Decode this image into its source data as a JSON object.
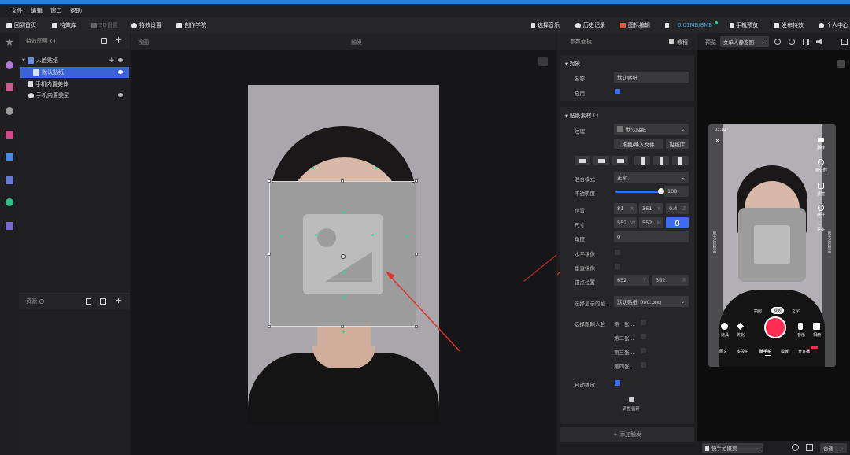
{
  "app": {
    "title": "特效君"
  },
  "menu": [
    "文件",
    "编辑",
    "窗口",
    "帮助"
  ],
  "toolbar": {
    "home": "回到首页",
    "effects_lib": "特效库",
    "settings_3d": "3D设置",
    "effect_settings": "特效设置",
    "academy": "创作学院",
    "choose_music": "选择音乐",
    "history": "历史记录",
    "icon_edit": "图标编辑",
    "size": "0.01MB/8MB",
    "phone_preview": "手机预览",
    "publish": "发布特效",
    "profile": "个人中心"
  },
  "effect_layers": {
    "title": "特效图层",
    "rows": [
      {
        "label": "人脸贴纸"
      },
      {
        "label": "默认贴纸"
      },
      {
        "label": "手机内置美体"
      },
      {
        "label": "手机内置美型"
      }
    ]
  },
  "resources": {
    "title": "资源"
  },
  "view": {
    "title": "视图",
    "trigger_title": "触发"
  },
  "properties": {
    "title": "参数面板",
    "tutorial": "教程",
    "object": {
      "section": "对象",
      "name_label": "名称",
      "name_value": "默认贴纸",
      "enabled_label": "启用",
      "enabled": true
    },
    "sticker": {
      "section": "贴纸素材",
      "texture_label": "纹理",
      "texture_value": "默认贴纸",
      "drag_import": "拖拽/导入文件",
      "sticker_lib": "贴纸库",
      "blend_label": "混合模式",
      "blend_value": "正常",
      "opacity_label": "不透明度",
      "opacity_value": "100",
      "opacity_fraction": 1.0,
      "position_label": "位置",
      "pos_x": "81",
      "pos_x_axis": "X",
      "pos_y": "361",
      "pos_y_axis": "Y",
      "pos_z": "0.4",
      "pos_z_axis": "Z",
      "size_label": "尺寸",
      "size_w": "552",
      "size_w_axis": "W",
      "size_h": "552",
      "size_h_axis": "H",
      "angle_label": "角度",
      "angle_value": "0",
      "flip_h_label": "水平镜像",
      "flip_v_label": "垂直镜像",
      "anchor_label": "锚点位置",
      "anchor_x": "652",
      "anchor_x_axis": "Y",
      "anchor_y": "362",
      "anchor_y_axis": "X",
      "frame_label": "选择显示的帧...",
      "frame_value": "默认贴纸_000.png",
      "track_face_label": "选择跟踪人脸",
      "face1": "第一张...",
      "face2": "第二张...",
      "face3": "第三张...",
      "face4": "第四张...",
      "autoplay_label": "自动播放",
      "autoplay": true,
      "loop_label": "调整循环"
    },
    "add_trigger": "+ 添加触发"
  },
  "preview": {
    "label": "预览",
    "template": "女单人静态图",
    "status_time": "03:10",
    "right_icons": [
      "翻转",
      "倒计时",
      "滤镜",
      "倒计",
      "更多"
    ],
    "side_text_left": "暂无选择物品",
    "side_text_right": "暂无选择物品",
    "mode_tabs": [
      "拍照",
      "视频",
      "文字"
    ],
    "bottom_icons": [
      "道具",
      "美化",
      "音乐",
      "相册"
    ],
    "bottom_tabs": [
      "图文",
      "多段拍",
      "随手拍",
      "模板",
      "开直播"
    ],
    "device": "快手拍摄页",
    "fit": "合适"
  },
  "colors": {
    "accent": "#3a64d8",
    "record": "#ff2d55",
    "title_bar": "#2a7fd6",
    "handle_point": "#2fd6a0"
  }
}
